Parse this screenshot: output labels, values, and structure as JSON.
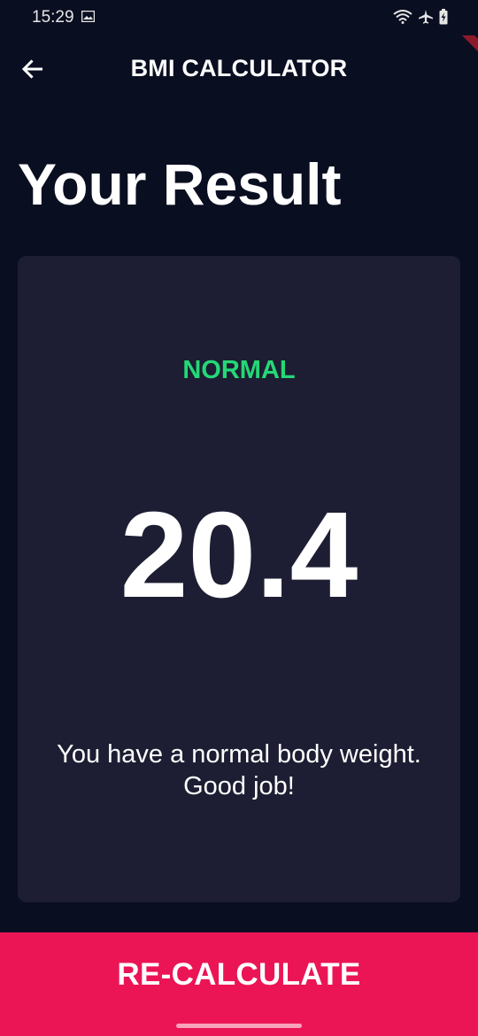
{
  "status_bar": {
    "time": "15:29",
    "icons": [
      "gallery-icon",
      "wifi-icon",
      "airplane-icon",
      "battery-charging-icon"
    ]
  },
  "app_bar": {
    "back_icon": "arrow-left-icon",
    "title": "BMI CALCULATOR"
  },
  "page": {
    "title": "Your Result"
  },
  "result": {
    "status": "NORMAL",
    "bmi": "20.4",
    "interpretation_line1": "You have a normal body weight.",
    "interpretation_line2": "Good job!"
  },
  "actions": {
    "recalculate_label": "RE-CALCULATE"
  },
  "colors": {
    "background": "#0a0e21",
    "card": "#1d1e33",
    "status_normal": "#24d876",
    "accent": "#eb1555"
  }
}
